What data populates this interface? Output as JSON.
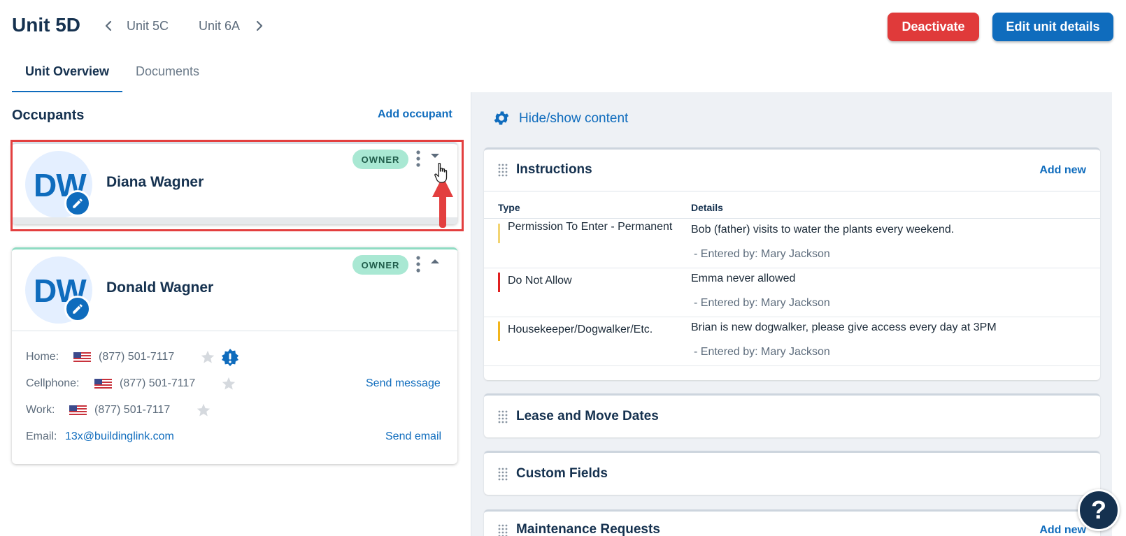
{
  "header": {
    "unit_title": "Unit 5D",
    "prev_unit": "Unit 5C",
    "next_unit": "Unit 6A",
    "deactivate_label": "Deactivate",
    "edit_label": "Edit unit details"
  },
  "tabs": [
    {
      "label": "Unit Overview",
      "active": true
    },
    {
      "label": "Documents",
      "active": false
    }
  ],
  "occupants": {
    "title": "Occupants",
    "add_label": "Add occupant",
    "items": [
      {
        "initials": "DW",
        "name": "Diana Wagner",
        "badge": "OWNER",
        "expanded": false
      },
      {
        "initials": "DW",
        "name": "Donald Wagner",
        "badge": "OWNER",
        "expanded": true,
        "contacts": {
          "home_label": "Home:",
          "home_phone": "(877) 501-7117",
          "cell_label": "Cellphone:",
          "cell_phone": "(877) 501-7117",
          "send_message": "Send message",
          "work_label": "Work:",
          "work_phone": "(877) 501-7117",
          "email_label": "Email:",
          "email": "13x@buildinglink.com",
          "send_email": "Send email"
        }
      }
    ]
  },
  "right_panel": {
    "hide_show_label": "Hide/show content",
    "instructions": {
      "title": "Instructions",
      "add_label": "Add new",
      "columns": [
        "Type",
        "Details"
      ],
      "rows": [
        {
          "type": "Permission To Enter - Permanent",
          "color": "#f2d472",
          "details": "Bob (father) visits to water the plants every weekend.",
          "entered_by": "- Entered by: Mary Jackson"
        },
        {
          "type": "Do Not Allow",
          "color": "#e02020",
          "details": "Emma never allowed",
          "entered_by": "- Entered by: Mary Jackson"
        },
        {
          "type": "Housekeeper/Dogwalker/Etc.",
          "color": "#f2b51c",
          "details": "Brian is new dogwalker, please give access every day at 3PM",
          "entered_by": "- Entered by: Mary Jackson"
        }
      ]
    },
    "lease_title": "Lease and Move Dates",
    "custom_title": "Custom Fields",
    "maintenance_title": "Maintenance Requests",
    "maintenance_add_label": "Add new"
  },
  "help_label": "?",
  "colors": {
    "primary": "#0f6cbd",
    "danger": "#e03a3a",
    "navy": "#15314f",
    "owner_badge": "#a9e8d3",
    "highlight": "#e33f3f"
  }
}
